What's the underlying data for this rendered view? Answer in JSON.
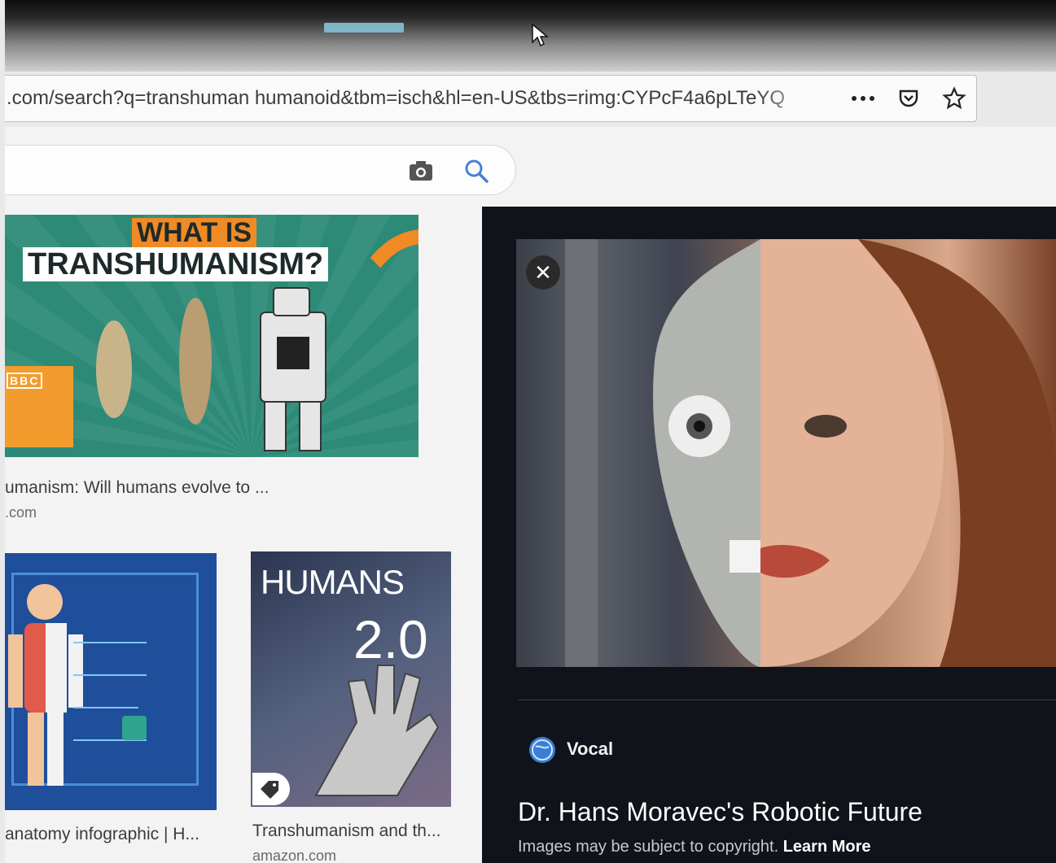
{
  "browser": {
    "url": ".com/search?q=transhuman humanoid&tbm=isch&hl=en-US&tbs=rimg:CYPcF4a6pLTeYQ",
    "icons": [
      "more-actions-icon",
      "pocket-icon",
      "bookmark-star-icon"
    ]
  },
  "search": {
    "icons": [
      "camera-icon",
      "search-icon"
    ]
  },
  "results": [
    {
      "overlay_line1": "WHAT IS",
      "overlay_line2": "TRANSHUMANISM?",
      "badge": "BBC",
      "caption": "umanism: Will humans evolve to ...",
      "source": ".com"
    },
    {
      "caption": "anatomy infographic | H...",
      "source": ""
    },
    {
      "cover_title": "HUMANS",
      "cover_number": "2.0",
      "caption": "Transhumanism and th...",
      "source": "amazon.com"
    }
  ],
  "preview": {
    "site": "Vocal",
    "title": "Dr. Hans Moravec's Robotic Future",
    "copyright_text": "Images may be subject to copyright.",
    "learn_more": "Learn More",
    "close_symbol": "✕"
  },
  "colors": {
    "accent": "#f08a24",
    "teal": "#2c8a77",
    "panel_bg": "#101319",
    "tab_indicator": "#7fb5c6"
  }
}
